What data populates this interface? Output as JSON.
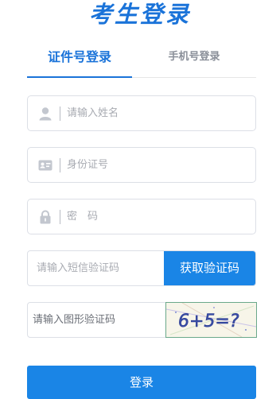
{
  "title": "考生登录",
  "tabs": [
    {
      "label": "证件号登录",
      "active": true
    },
    {
      "label": "手机号登录",
      "active": false
    }
  ],
  "fields": {
    "name": {
      "placeholder": "请输入姓名",
      "icon": "user-icon"
    },
    "id_number": {
      "placeholder": "身份证号",
      "icon": "id-card-icon"
    },
    "password": {
      "placeholder": "密　码",
      "icon": "lock-icon"
    },
    "sms_code": {
      "placeholder": "请输入短信验证码"
    },
    "captcha": {
      "placeholder": "请输入图形验证码"
    }
  },
  "sms_button": "获取验证码",
  "captcha_text": "6+5=?",
  "login_button": "登录",
  "colors": {
    "accent": "#1a73d9",
    "button": "#1a85e6",
    "border": "#dcdfe6",
    "placeholder": "#a8abb2"
  }
}
